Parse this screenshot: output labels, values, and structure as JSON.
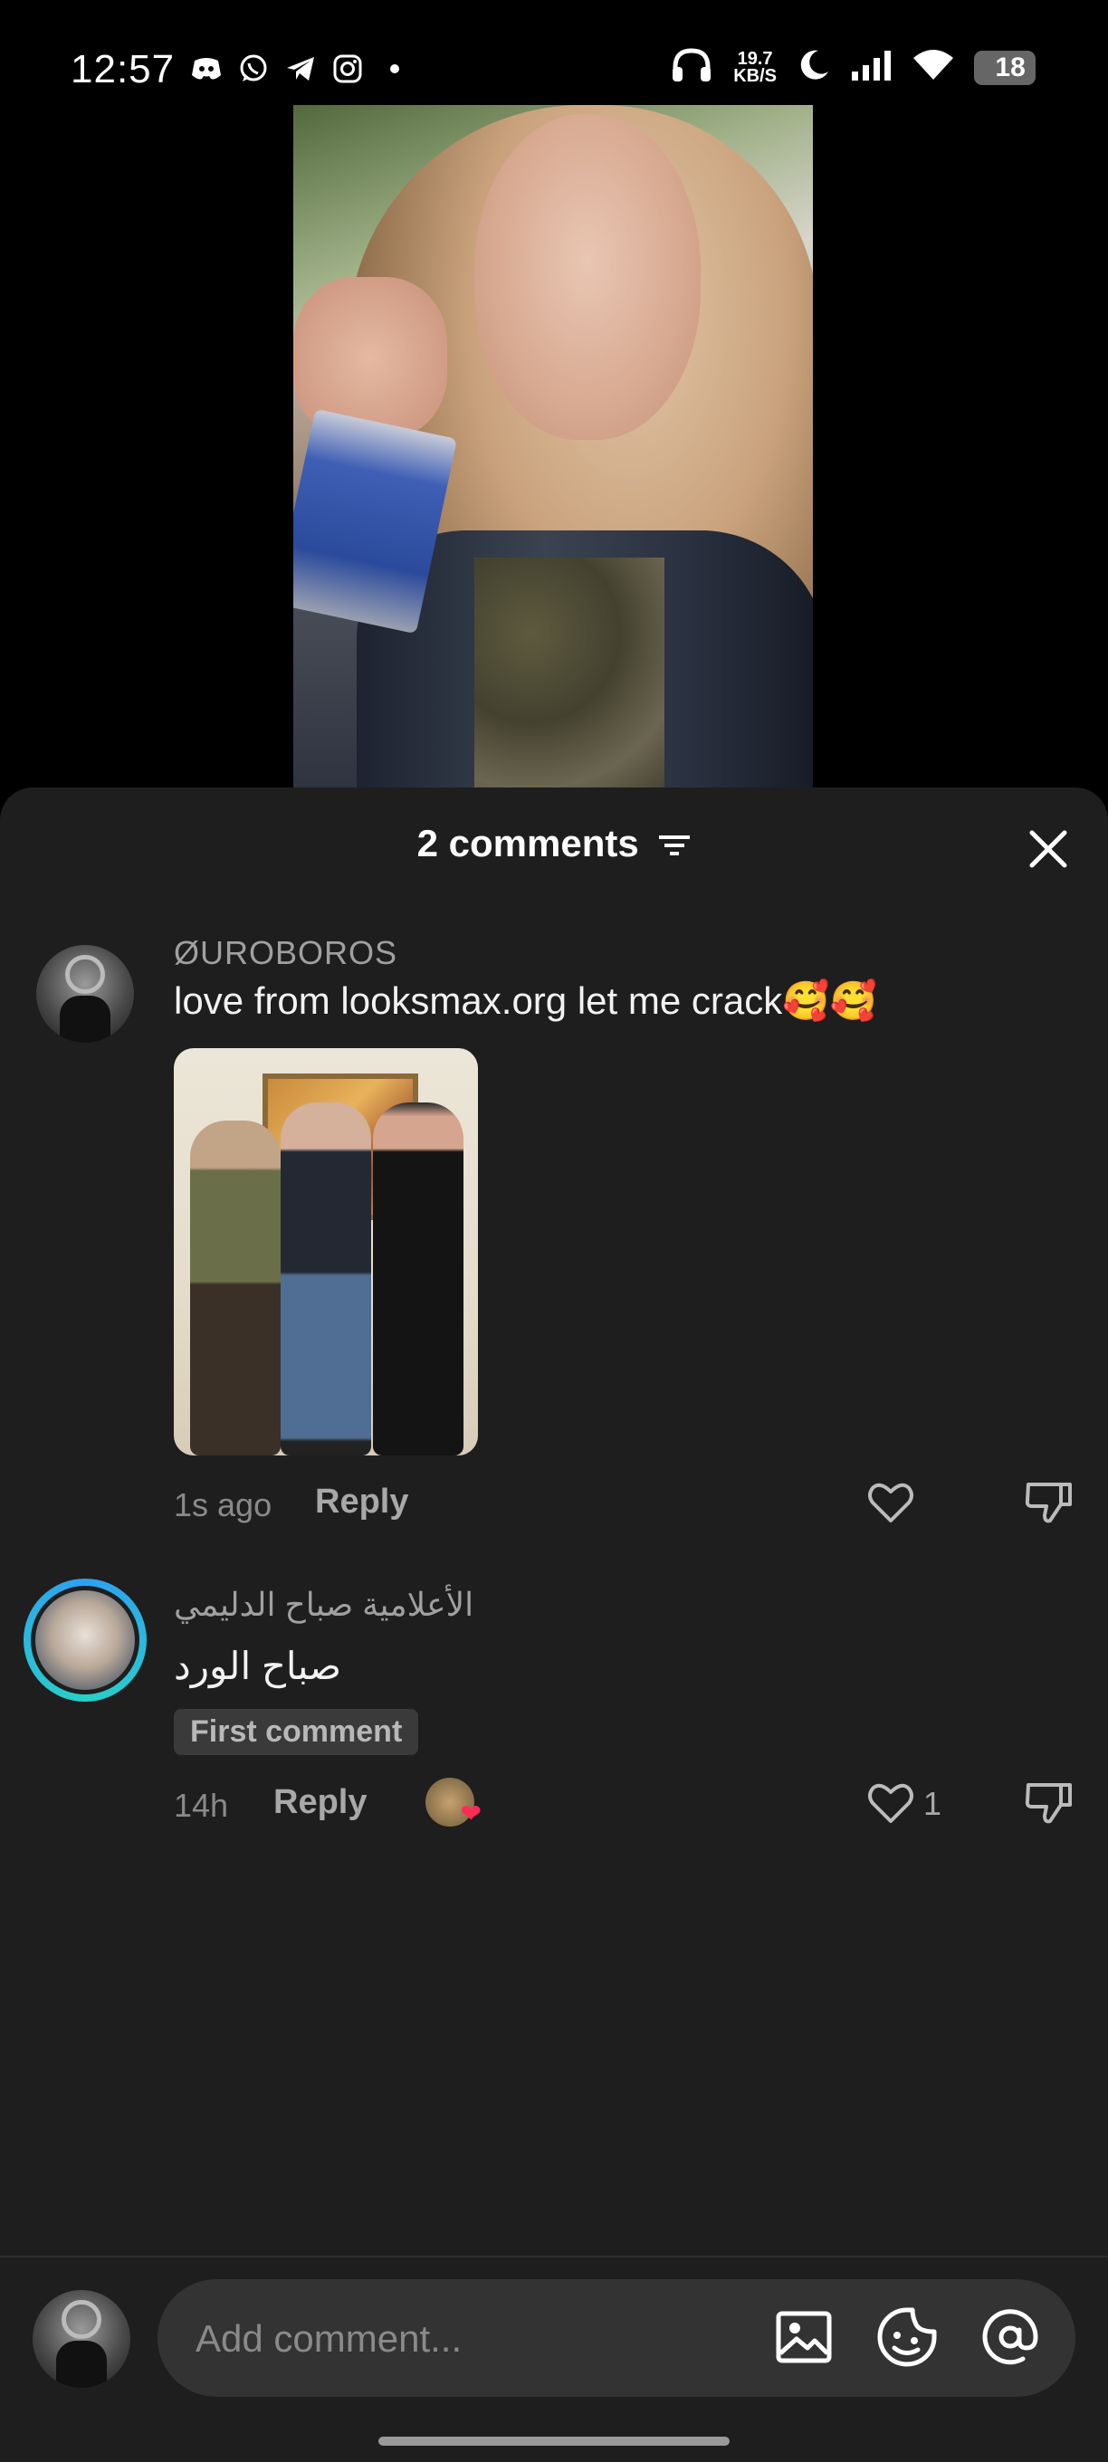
{
  "status_bar": {
    "time": "12:57",
    "net_speed_value": "19.7",
    "net_speed_unit": "KB/S",
    "battery_level": "18",
    "battery_color": "#e84a4a",
    "left_icons": [
      "discord-icon",
      "whatsapp-icon",
      "telegram-icon",
      "instagram-icon",
      "dot-icon"
    ],
    "right_icons": [
      "headphones-icon",
      "moon-icon",
      "signal-icon",
      "wifi-icon",
      "battery-icon"
    ]
  },
  "sheet": {
    "title": "2 comments",
    "filter_icon": "filter-icon",
    "close_icon": "close-icon"
  },
  "comments": [
    {
      "username": "ØUROBOROS",
      "text": "love from looksmax.org let me crack🥰🥰",
      "time": "1s ago",
      "reply_label": "Reply",
      "has_image": true,
      "likes": ""
    },
    {
      "username": "الأعلامية صباح الدليمي",
      "text": "صباح الورد",
      "badge": "First comment",
      "time": "14h",
      "reply_label": "Reply",
      "reaction_heart": "❤",
      "likes": "1"
    }
  ],
  "composer": {
    "placeholder": "Add comment...",
    "icons": [
      "image-icon",
      "sticker-icon",
      "mention-icon"
    ]
  },
  "colors": {
    "sheet_bg": "#1e1e1e",
    "story_ring": "#2ea0f0"
  }
}
